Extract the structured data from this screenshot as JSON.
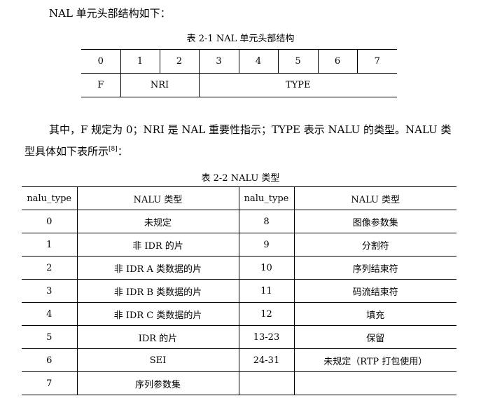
{
  "intro": "NAL 单元头部结构如下：",
  "table1": {
    "caption": "表 2-1 NAL 单元头部结构",
    "bits": [
      "0",
      "1",
      "2",
      "3",
      "4",
      "5",
      "6",
      "7"
    ],
    "fields": [
      "F",
      "NRI",
      "TYPE"
    ]
  },
  "paragraph": {
    "text": "其中，F 规定为 0；NRI 是 NAL 重要性指示；TYPE 表示 NALU 的类型。NALU 类型具体如下表所示",
    "citation": "[8]",
    "end": "："
  },
  "table2": {
    "caption": "表 2-2 NALU 类型",
    "headers": [
      "nalu_type",
      "NALU 类型",
      "nalu_type",
      "NALU 类型"
    ],
    "rows": [
      [
        "0",
        "未规定",
        "8",
        "图像参数集"
      ],
      [
        "1",
        "非 IDR 的片",
        "9",
        "分割符"
      ],
      [
        "2",
        "非 IDR A 类数据的片",
        "10",
        "序列结束符"
      ],
      [
        "3",
        "非 IDR B 类数据的片",
        "11",
        "码流结束符"
      ],
      [
        "4",
        "非 IDR C 类数据的片",
        "12",
        "填充"
      ],
      [
        "5",
        "IDR 的片",
        "13-23",
        "保留"
      ],
      [
        "6",
        "SEI",
        "24-31",
        "未规定（RTP 打包使用）"
      ],
      [
        "7",
        "序列参数集",
        "",
        ""
      ]
    ]
  }
}
